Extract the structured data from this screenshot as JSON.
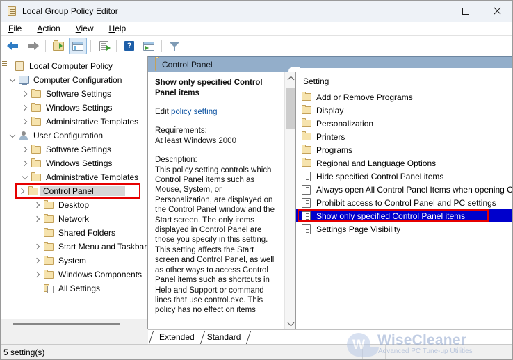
{
  "window": {
    "title": "Local Group Policy Editor",
    "title_icon": "policy-scroll-icon",
    "minimize_label": "Minimize",
    "maximize_label": "Maximize",
    "close_label": "Close"
  },
  "menubar": {
    "items": [
      {
        "pre": "F",
        "rest": "ile",
        "name": "menu-file"
      },
      {
        "pre": "A",
        "rest": "ction",
        "name": "menu-action"
      },
      {
        "pre": "V",
        "rest": "iew",
        "name": "menu-view"
      },
      {
        "pre": "H",
        "rest": "elp",
        "name": "menu-help"
      }
    ]
  },
  "toolbar": {
    "buttons": [
      {
        "name": "back-button",
        "icon": "back-arrow-icon"
      },
      {
        "name": "forward-button",
        "icon": "forward-arrow-icon"
      },
      {
        "name": "up-one-level-button",
        "icon": "folder-up-icon"
      },
      {
        "name": "show-hide-console-tree-button",
        "icon": "console-tree-icon",
        "pressed": true
      },
      {
        "name": "export-list-button",
        "icon": "export-list-icon"
      },
      {
        "name": "help-button",
        "icon": "help-icon"
      },
      {
        "name": "show-hide-action-pane-button",
        "icon": "action-pane-icon"
      },
      {
        "name": "filter-button",
        "icon": "filter-icon"
      }
    ]
  },
  "tree": {
    "nodes": [
      {
        "label": "Local Computer Policy",
        "indent": 0,
        "chev": "none",
        "icon": "policy-scroll-icon"
      },
      {
        "label": "Computer Configuration",
        "indent": 1,
        "chev": "open",
        "icon": "computer-icon"
      },
      {
        "label": "Software Settings",
        "indent": 2,
        "chev": "closed",
        "icon": "folder-icon"
      },
      {
        "label": "Windows Settings",
        "indent": 2,
        "chev": "closed",
        "icon": "folder-icon"
      },
      {
        "label": "Administrative Templates",
        "indent": 2,
        "chev": "closed",
        "icon": "folder-icon"
      },
      {
        "label": "User Configuration",
        "indent": 1,
        "chev": "open",
        "icon": "user-icon"
      },
      {
        "label": "Software Settings",
        "indent": 2,
        "chev": "closed",
        "icon": "folder-icon"
      },
      {
        "label": "Windows Settings",
        "indent": 2,
        "chev": "closed",
        "icon": "folder-icon"
      },
      {
        "label": "Administrative Templates",
        "indent": 2,
        "chev": "open",
        "icon": "folder-icon"
      },
      {
        "label": "Control Panel",
        "indent": 3,
        "chev": "closed",
        "icon": "folder-icon",
        "selected": true,
        "highlight": "red-box"
      },
      {
        "label": "Desktop",
        "indent": 3,
        "chev": "closed",
        "icon": "folder-icon"
      },
      {
        "label": "Network",
        "indent": 3,
        "chev": "closed",
        "icon": "folder-icon"
      },
      {
        "label": "Shared Folders",
        "indent": 3,
        "chev": "none",
        "icon": "folder-icon"
      },
      {
        "label": "Start Menu and Taskbar",
        "indent": 3,
        "chev": "closed",
        "icon": "folder-icon"
      },
      {
        "label": "System",
        "indent": 3,
        "chev": "closed",
        "icon": "folder-icon"
      },
      {
        "label": "Windows Components",
        "indent": 3,
        "chev": "closed",
        "icon": "folder-icon"
      },
      {
        "label": "All Settings",
        "indent": 3,
        "chev": "none",
        "icon": "all-settings-icon"
      }
    ]
  },
  "pane_header": {
    "title": "Control Panel",
    "icon": "folder-icon",
    "bg_color": "#93aeca"
  },
  "description": {
    "policy_title": "Show only specified Control Panel items",
    "edit_prefix": "Edit ",
    "edit_link": "policy setting",
    "requirements_label": "Requirements:",
    "requirements_value": "At least Windows 2000",
    "description_label": "Description:",
    "description_body": "This policy setting controls which Control Panel items such as Mouse, System, or Personalization, are displayed on the Control Panel window and the Start screen. The only items displayed in Control Panel are those you specify in this setting. This setting affects the Start screen and Control Panel, as well as other ways to access Control Panel items such as shortcuts in Help and Support or command lines that use control.exe. This policy has no effect on items"
  },
  "list": {
    "column_header": "Setting",
    "rows": [
      {
        "label": "Add or Remove Programs",
        "icon": "folder-icon",
        "selected": false
      },
      {
        "label": "Display",
        "icon": "folder-icon",
        "selected": false
      },
      {
        "label": "Personalization",
        "icon": "folder-icon",
        "selected": false
      },
      {
        "label": "Printers",
        "icon": "folder-icon",
        "selected": false
      },
      {
        "label": "Programs",
        "icon": "folder-icon",
        "selected": false
      },
      {
        "label": "Regional and Language Options",
        "icon": "folder-icon",
        "selected": false
      },
      {
        "label": "Hide specified Control Panel items",
        "icon": "policy-setting-icon",
        "selected": false
      },
      {
        "label": "Always open All Control Panel Items when opening Co",
        "icon": "policy-setting-icon",
        "selected": false
      },
      {
        "label": "Prohibit access to Control Panel and PC settings",
        "icon": "policy-setting-icon",
        "selected": false
      },
      {
        "label": "Show only specified Control Panel items",
        "icon": "policy-setting-icon",
        "selected": true,
        "highlight": "red-box"
      },
      {
        "label": "Settings Page Visibility",
        "icon": "policy-setting-icon",
        "selected": false
      }
    ]
  },
  "tabs": {
    "items": [
      {
        "label": "Extended",
        "name": "tab-extended",
        "active": false
      },
      {
        "label": "Standard",
        "name": "tab-standard",
        "active": true
      }
    ]
  },
  "statusbar": {
    "text": "5 setting(s)"
  },
  "watermark": {
    "mark": "W",
    "title": "WiseCleaner",
    "subtitle": "Advanced PC Tune-up Utilities",
    "color": "#8fa5cd"
  },
  "colors": {
    "header_blue": "#93aeca",
    "selection_blue": "#0000cc",
    "highlight_red": "#e60000",
    "link_blue": "#0b52a1"
  }
}
